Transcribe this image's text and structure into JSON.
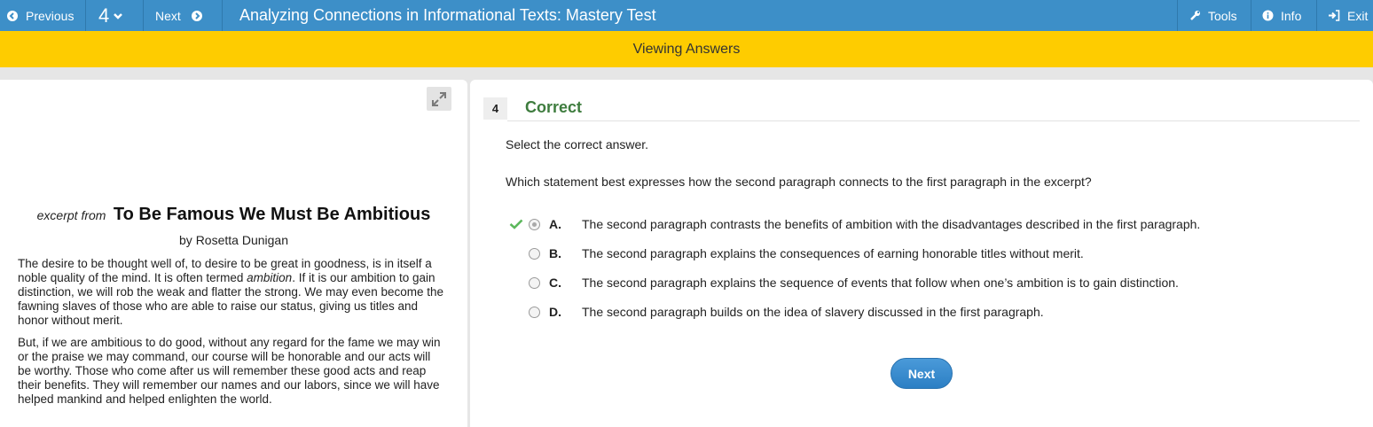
{
  "topbar": {
    "previous_label": "Previous",
    "question_number": "4",
    "next_label": "Next",
    "title": "Analyzing Connections in Informational Texts: Mastery Test",
    "tools_label": "Tools",
    "info_label": "Info",
    "exit_label": "Exit"
  },
  "banner": {
    "text": "Viewing Answers"
  },
  "passage": {
    "excerpt_from": "excerpt from",
    "title": "To Be Famous We Must Be Ambitious",
    "byline": "by Rosetta Dunigan",
    "para1_a": "The desire to be thought well of, to desire to be great in goodness, is in itself a noble quality of the mind. It is often termed ",
    "para1_em": "ambition",
    "para1_b": ". If it is our ambition to gain distinction, we will rob the weak and flatter the strong. We may even become the fawning slaves of those who are able to raise our status, giving us titles and honor without merit.",
    "para2": "But, if we are ambitious to do good, without any regard for the fame we may win or the praise we may command, our course will be honorable and our acts will be worthy. Those who come after us will remember these good acts and reap their benefits. They will remember our names and our labors, since we will have helped mankind and helped enlighten the world."
  },
  "question": {
    "number": "4",
    "status": "Correct",
    "instruction": "Select the correct answer.",
    "prompt": "Which statement best expresses how the second paragraph connects to the first paragraph in the excerpt?",
    "options": [
      {
        "letter": "A.",
        "text": "The second paragraph contrasts the benefits of ambition with the disadvantages described in the first paragraph."
      },
      {
        "letter": "B.",
        "text": "The second paragraph explains the consequences of earning honorable titles without merit."
      },
      {
        "letter": "C.",
        "text": "The second paragraph explains the sequence of events that follow when one’s ambition is to gain distinction."
      },
      {
        "letter": "D.",
        "text": "The second paragraph builds on the idea of slavery discussed in the first paragraph."
      }
    ],
    "next_button": "Next"
  },
  "colors": {
    "topbar": "#3d8fc8",
    "banner": "#fecc00",
    "correct": "#3e7c3e",
    "check": "#5cb85c"
  }
}
